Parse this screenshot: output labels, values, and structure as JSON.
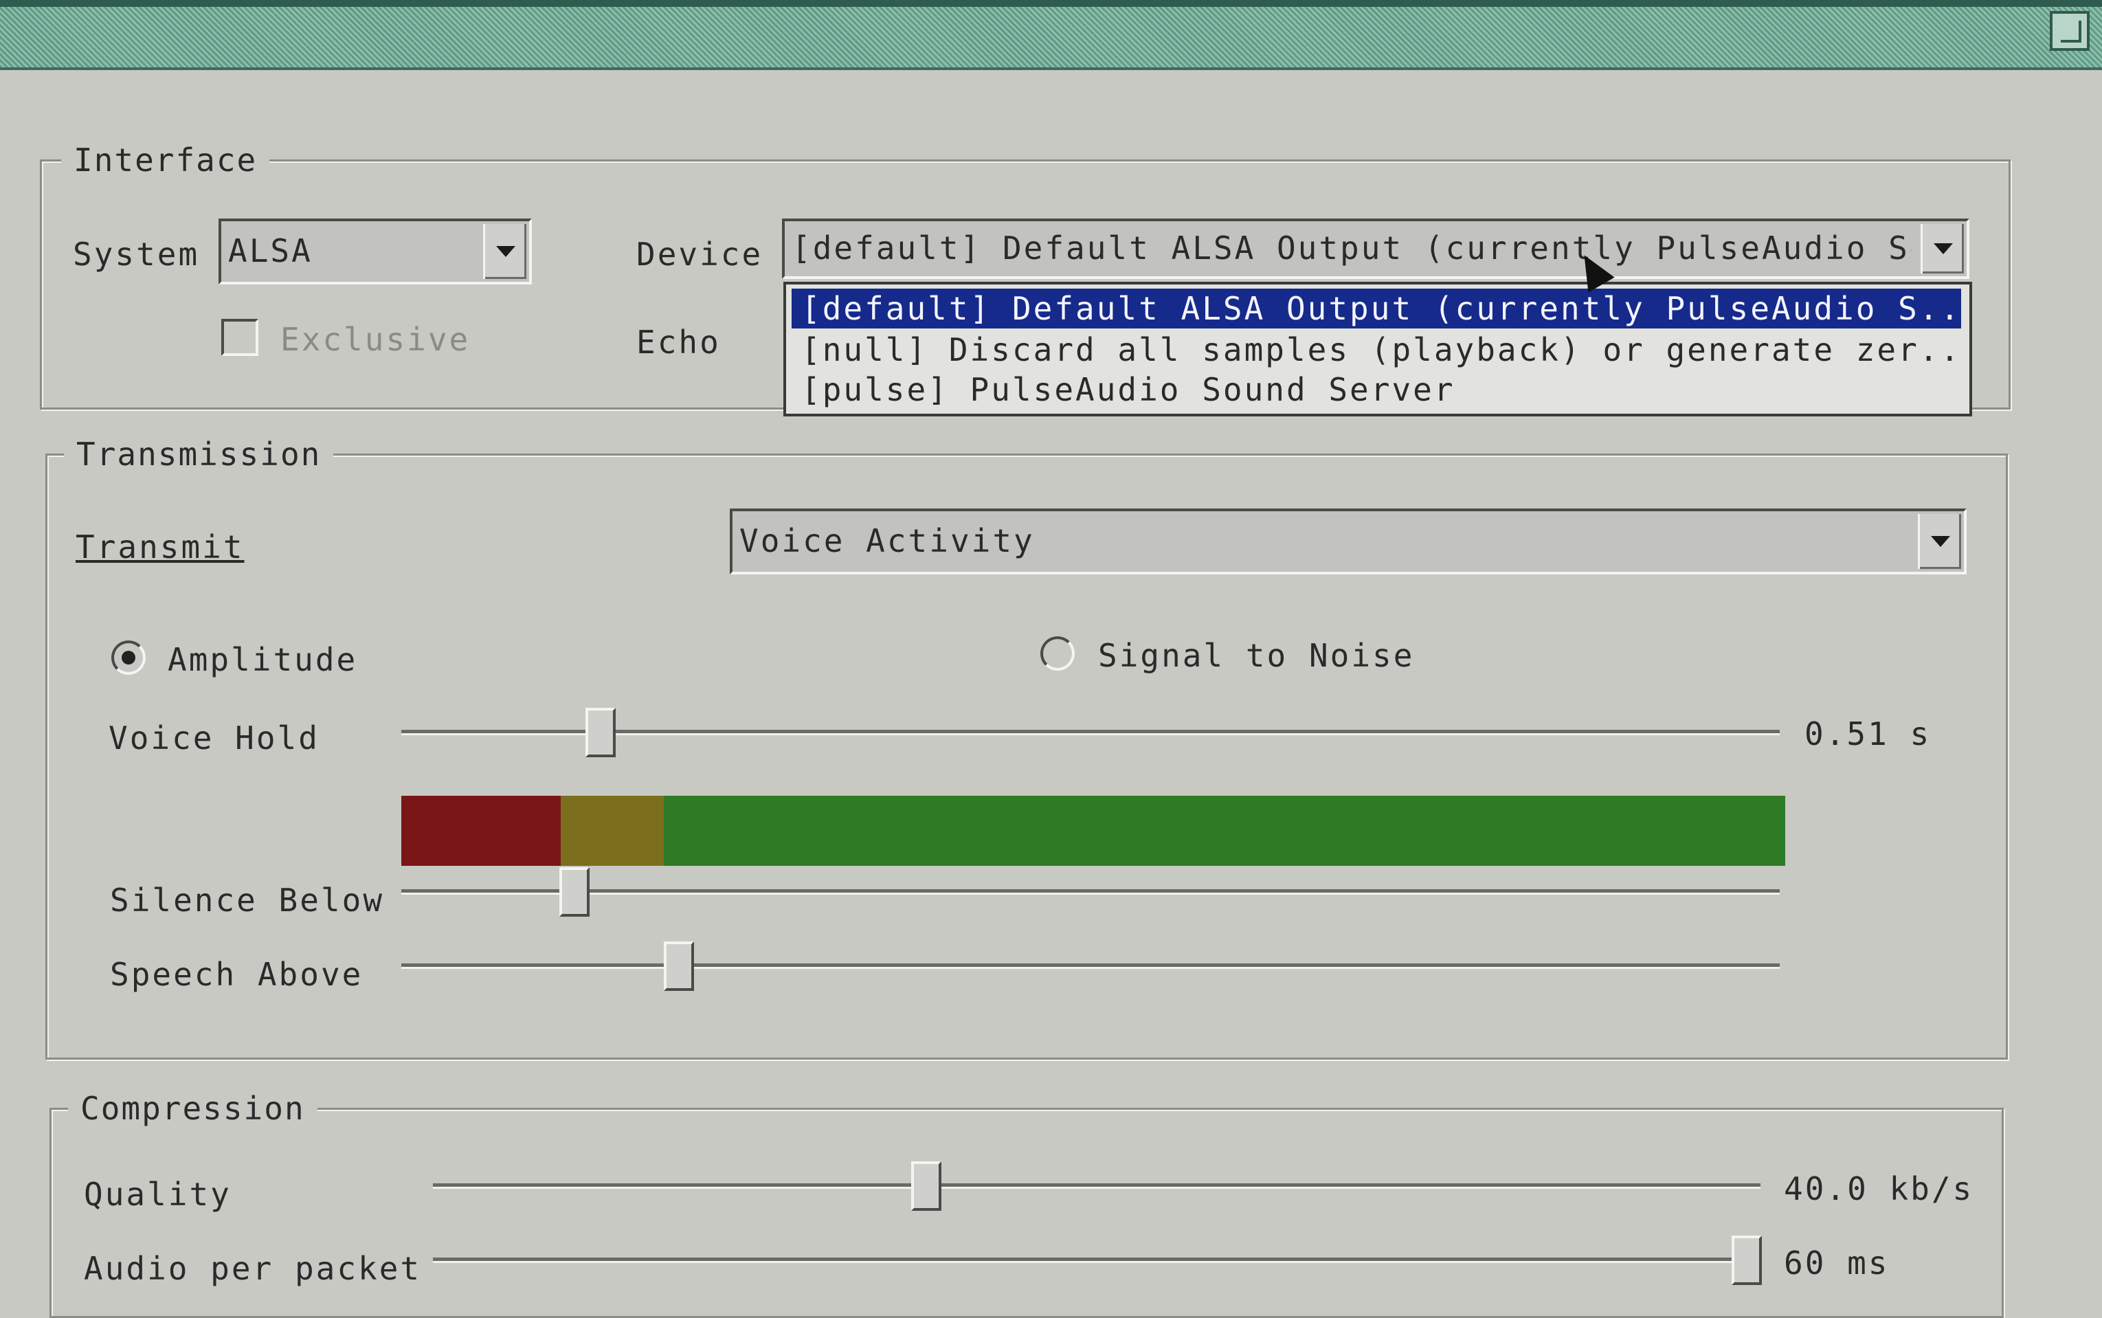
{
  "colors": {
    "meter_red": "#7a1616",
    "meter_yellow": "#7b6f1e",
    "meter_green": "#2f7a24",
    "selection": "#152a8a"
  },
  "interface": {
    "legend": "Interface",
    "system_label": "System",
    "system_value": "ALSA",
    "device_label": "Device",
    "device_value": "[default] Default ALSA Output (currently PulseAudio Sou",
    "exclusive_label": "Exclusive",
    "echo_label": "Echo",
    "device_options": [
      "[default] Default ALSA Output (currently PulseAudio S...",
      "[null] Discard all samples (playback) or generate zer...",
      "[pulse] PulseAudio Sound Server"
    ]
  },
  "transmission": {
    "legend": "Transmission",
    "transmit_label": "Transmit",
    "transmit_value": "Voice Activity",
    "amplitude_label": "Amplitude",
    "snr_label": "Signal to Noise",
    "voice_hold_label": "Voice Hold",
    "voice_hold_value": "0.51 s",
    "silence_below_label": "Silence Below",
    "speech_above_label": "Speech Above"
  },
  "compression": {
    "legend": "Compression",
    "quality_label": "Quality",
    "quality_value": "40.0 kb/s",
    "audio_per_packet_label": "Audio per packet",
    "audio_per_packet_value": "60 ms"
  }
}
